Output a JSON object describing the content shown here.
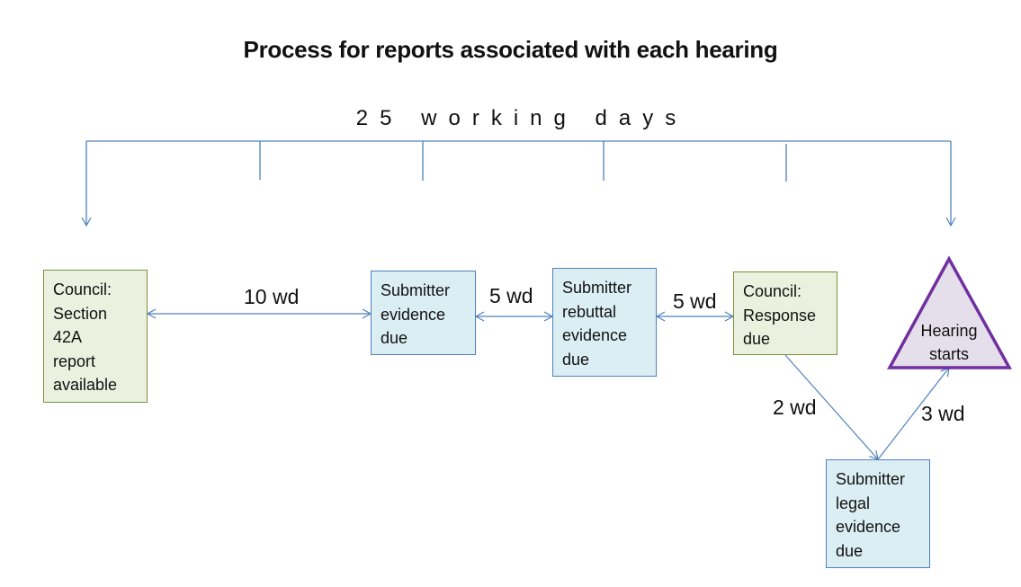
{
  "title": "Process for reports associated with each hearing",
  "span_label": "25 working days",
  "colors": {
    "connector": "#4f81bd",
    "council_fill": "#ebf1de",
    "council_border": "#77933c",
    "submitter_fill": "#dbeef4",
    "submitter_border": "#4f81bd",
    "hearing_fill": "#e5dfec",
    "hearing_border": "#7030a0"
  },
  "steps": [
    {
      "id": "council-s42a",
      "kind": "council",
      "lines": [
        "Council:",
        "Section",
        "42A",
        "report",
        "available"
      ]
    },
    {
      "id": "submitter-evidence",
      "kind": "submitter",
      "lines": [
        "Submitter",
        "evidence",
        "due"
      ]
    },
    {
      "id": "submitter-rebuttal",
      "kind": "submitter",
      "lines": [
        "Submitter",
        "rebuttal",
        "evidence",
        "due"
      ]
    },
    {
      "id": "council-response",
      "kind": "council",
      "lines": [
        "Council:",
        "Response",
        "due"
      ]
    },
    {
      "id": "submitter-legal",
      "kind": "submitter",
      "lines": [
        "Submitter",
        "legal",
        "evidence",
        "due"
      ]
    },
    {
      "id": "hearing-starts",
      "kind": "hearing",
      "lines": [
        "Hearing",
        "starts"
      ]
    }
  ],
  "durations": [
    {
      "from": "council-s42a",
      "to": "submitter-evidence",
      "label": "10 wd"
    },
    {
      "from": "submitter-evidence",
      "to": "submitter-rebuttal",
      "label": "5 wd"
    },
    {
      "from": "submitter-rebuttal",
      "to": "council-response",
      "label": "5 wd"
    },
    {
      "from": "council-response",
      "to": "submitter-legal",
      "label": "2 wd"
    },
    {
      "from": "submitter-legal",
      "to": "hearing-starts",
      "label": "3 wd"
    }
  ]
}
